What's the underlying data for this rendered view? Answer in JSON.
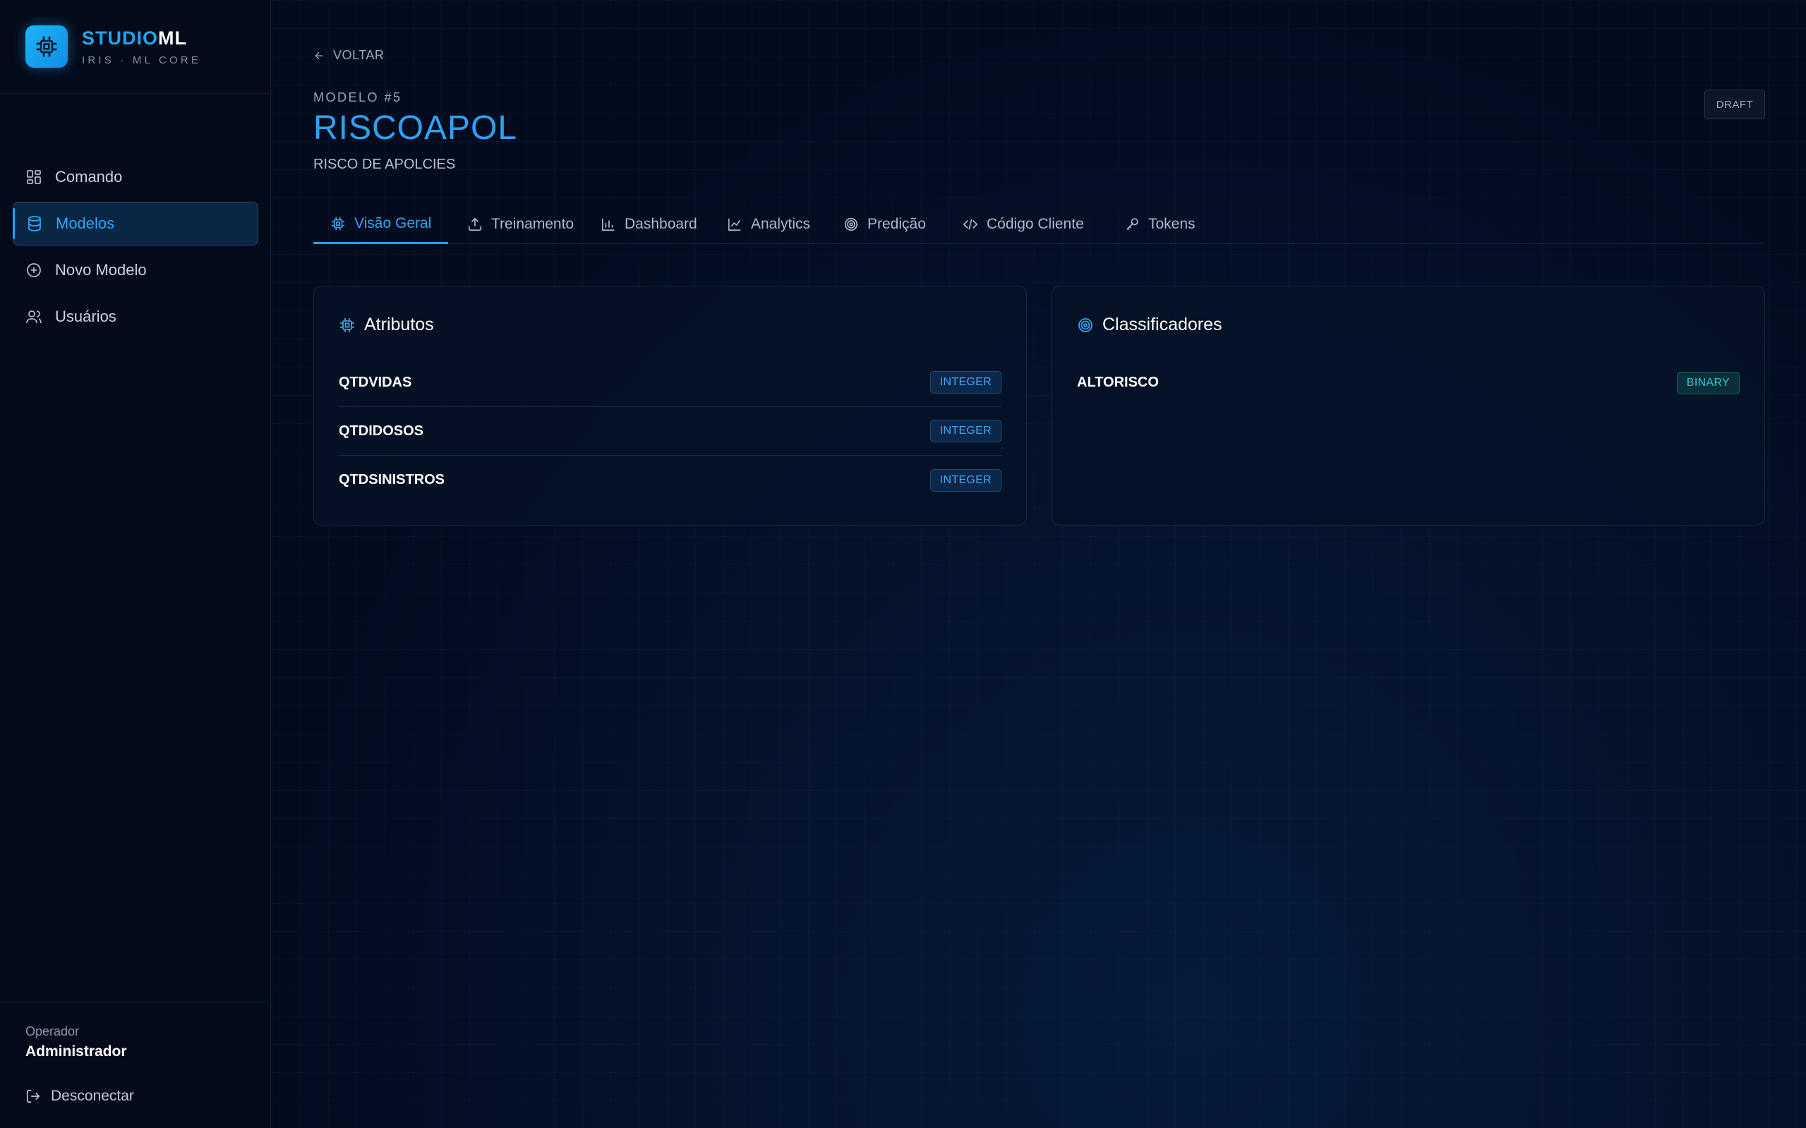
{
  "brand": {
    "name_part1": "STUDIO",
    "name_part2": "ML",
    "subtitle": "IRIS · ML CORE",
    "logo_icon": "cpu-chip-icon"
  },
  "sidebar": {
    "items": [
      {
        "label": "Comando",
        "icon": "dashboard-grid-icon",
        "active": false
      },
      {
        "label": "Modelos",
        "icon": "database-icon",
        "active": true
      },
      {
        "label": "Novo Modelo",
        "icon": "plus-circle-icon",
        "active": false
      },
      {
        "label": "Usuários",
        "icon": "users-icon",
        "active": false
      }
    ],
    "operator_label": "Operador",
    "operator_name": "Administrador",
    "logout_label": "Desconectar"
  },
  "header": {
    "back_label": "VOLTAR",
    "model_number": "MODELO #5",
    "model_name": "RISCOAPOL",
    "model_description": "RISCO DE APOLCIES",
    "status": "DRAFT"
  },
  "tabs": [
    {
      "label": "Visão Geral",
      "icon": "cpu-chip-icon",
      "active": true
    },
    {
      "label": "Treinamento",
      "icon": "upload-icon",
      "active": false
    },
    {
      "label": "Dashboard",
      "icon": "bar-chart-icon",
      "active": false
    },
    {
      "label": "Analytics",
      "icon": "line-chart-icon",
      "active": false
    },
    {
      "label": "Predição",
      "icon": "target-icon",
      "active": false
    },
    {
      "label": "Código Cliente",
      "icon": "code-icon",
      "active": false
    },
    {
      "label": "Tokens",
      "icon": "key-icon",
      "active": false
    }
  ],
  "attributes_card": {
    "title": "Atributos",
    "items": [
      {
        "name": "QTDVIDAS",
        "type": "INTEGER"
      },
      {
        "name": "QTDIDOSOS",
        "type": "INTEGER"
      },
      {
        "name": "QTDSINISTROS",
        "type": "INTEGER"
      }
    ]
  },
  "classifiers_card": {
    "title": "Classificadores",
    "items": [
      {
        "name": "ALTORISCO",
        "type": "BINARY"
      }
    ]
  },
  "colors": {
    "accent": "#1ea4f0",
    "integer_badge": "#3fa8f2",
    "binary_badge": "#34c4d4",
    "background": "#04102a"
  }
}
